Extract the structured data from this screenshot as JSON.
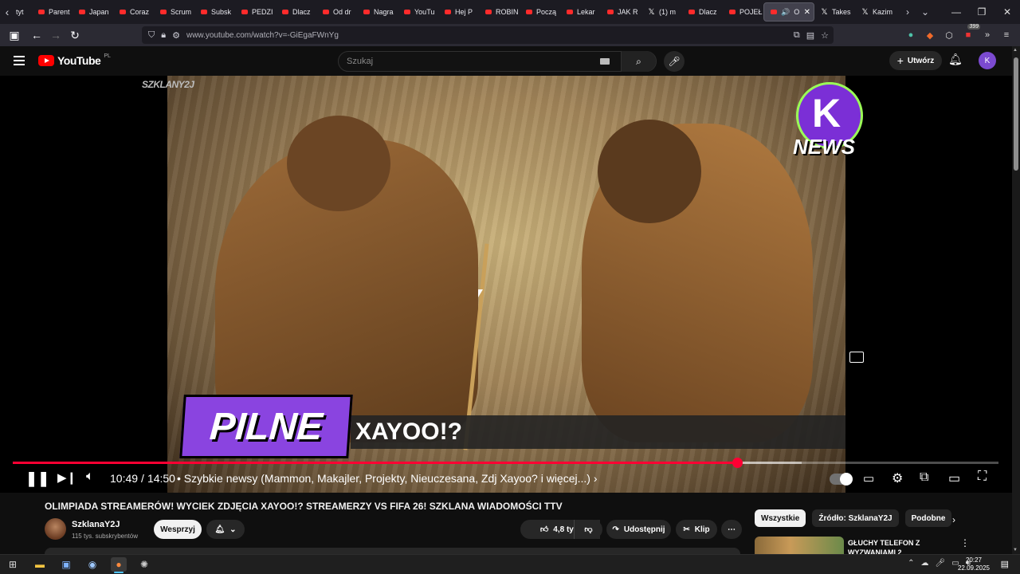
{
  "browser": {
    "tabs": [
      {
        "label": "Parent",
        "icon": "youtube-icon"
      },
      {
        "label": "Japan",
        "icon": "youtube-icon"
      },
      {
        "label": "Coraz",
        "icon": "youtube-icon"
      },
      {
        "label": "Scrum",
        "icon": "youtube-icon"
      },
      {
        "label": "Subsk",
        "icon": "youtube-icon"
      },
      {
        "label": "PEDZI",
        "icon": "youtube-icon"
      },
      {
        "label": "Dlacz",
        "icon": "youtube-icon"
      },
      {
        "label": "Od dr",
        "icon": "youtube-icon"
      },
      {
        "label": "Nagra",
        "icon": "youtube-icon"
      },
      {
        "label": "YouTu",
        "icon": "youtube-icon"
      },
      {
        "label": "Hej P",
        "icon": "youtube-icon"
      },
      {
        "label": "ROBIN",
        "icon": "youtube-icon"
      },
      {
        "label": "Począ",
        "icon": "youtube-icon"
      },
      {
        "label": "Lekar",
        "icon": "youtube-icon"
      },
      {
        "label": "JAK R",
        "icon": "youtube-icon"
      },
      {
        "label": "(1) m",
        "icon": "x-icon"
      },
      {
        "label": "Dlacz",
        "icon": "youtube-icon"
      },
      {
        "label": "POJEŁ",
        "icon": "youtube-icon"
      }
    ],
    "first_tab_partial": "tyt",
    "active_tab": {
      "label": "OL",
      "close": "✕"
    },
    "after_tabs": [
      {
        "label": "Takes",
        "icon": "x-icon"
      },
      {
        "label": "Kazim",
        "icon": "x-icon"
      }
    ],
    "url": "www.youtube.com/watch?v=-GiEgaFWnYg",
    "extension_badge": "399"
  },
  "youtube": {
    "logo_text": "YouTube",
    "country_code": "PL",
    "search_placeholder": "Szukaj",
    "create_label": "Utwórz",
    "avatar_letter": "K"
  },
  "video": {
    "watermark_tl": "SZKLANY2J",
    "news_logo_text": "NEWS",
    "banner_label": "PILNE",
    "banner_headline": "XAYOO!?",
    "current_time": "10:49",
    "separator": "/",
    "duration": "14:50",
    "chapter": "• Szybkie newsy (Mammon, Makajler, Projekty, Nieuczesana, Zdj Xayoo? i więcej...) ›",
    "progress_fraction": 0.7348,
    "buffered_fraction": 0.8
  },
  "meta": {
    "title": "OLIMPIADA STREAMERÓW! WYCIEK ZDJĘCIA XAYOO!? STREAMERZY VS FIFA 26! SZKLANA WIADOMOŚCI TTV",
    "channel_name": "SzklanaY2J",
    "channel_subs": "115 tys. subskrybentów",
    "support_label": "Wesprzyj",
    "likes": "4,8 tys.",
    "share_label": "Udostępnij",
    "clip_label": "Klip"
  },
  "recommendations": {
    "chips": [
      "Wszystkie",
      "Źródło: SzklanaY2J",
      "Podobne"
    ],
    "first_title": "GŁUCHY TELEFON Z WYZWANIAMI 2"
  },
  "taskbar": {
    "time": "20:27",
    "date": "22.09.2025"
  }
}
